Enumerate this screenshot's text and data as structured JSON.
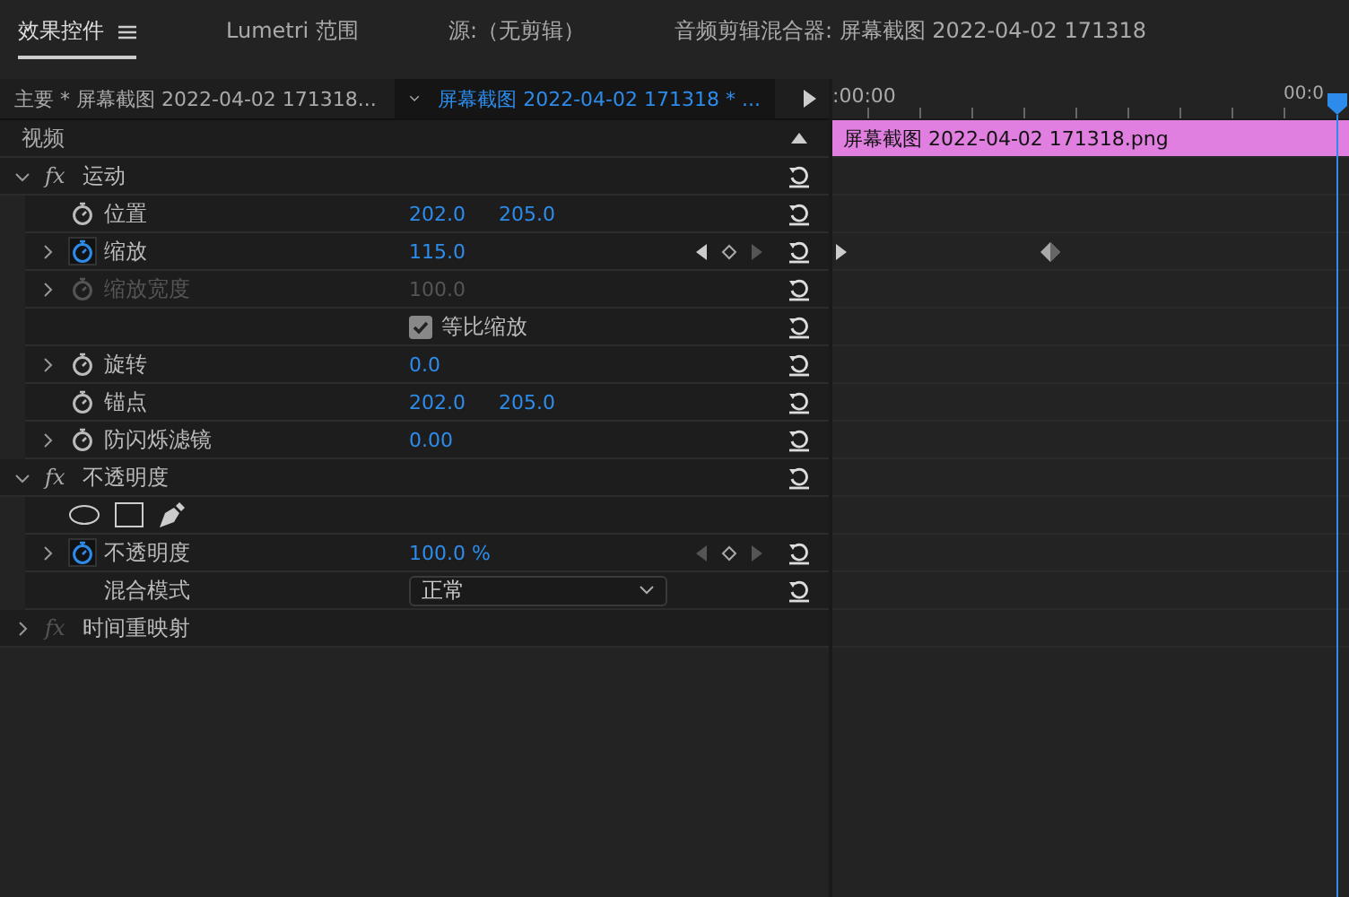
{
  "tabs": [
    {
      "label": "效果控件",
      "selected": true,
      "menu": true
    },
    {
      "label": "Lumetri 范围",
      "selected": false,
      "menu": false
    },
    {
      "label": "源:（无剪辑）",
      "selected": false,
      "menu": false
    },
    {
      "label": "音频剪辑混合器: 屏幕截图 2022-04-02 171318",
      "selected": false,
      "menu": false
    }
  ],
  "header": {
    "master_clip": "主要 * 屏幕截图 2022-04-02 171318...",
    "sequence_clip": "屏幕截图 2022-04-02 171318 * ..."
  },
  "timeline": {
    "time_start": ":00:00",
    "time_end": "00:0",
    "clip_label": "屏幕截图 2022-04-02  171318.png"
  },
  "section": {
    "label": "视频"
  },
  "effects": [
    {
      "name": "运动",
      "badge": "fx",
      "expanded": true,
      "fx_enabled": true,
      "resettable": true,
      "properties": [
        {
          "kind": "value",
          "name": "位置",
          "expandable": false,
          "stopwatch": true,
          "animated": false,
          "disabled": false,
          "values": [
            "202.0",
            "205.0"
          ],
          "resettable": true
        },
        {
          "kind": "value",
          "name": "缩放",
          "expandable": true,
          "stopwatch": true,
          "animated": true,
          "disabled": false,
          "values": [
            "115.0"
          ],
          "keyframe_nav": {
            "prev": true,
            "next": false
          },
          "keyframe": true,
          "resettable": true
        },
        {
          "kind": "value",
          "name": "缩放宽度",
          "expandable": true,
          "stopwatch": true,
          "animated": false,
          "disabled": true,
          "values": [
            "100.0"
          ],
          "resettable": true
        },
        {
          "kind": "checkbox",
          "label": "等比缩放",
          "checked": true,
          "resettable": true
        },
        {
          "kind": "value",
          "name": "旋转",
          "expandable": true,
          "stopwatch": true,
          "animated": false,
          "disabled": false,
          "values": [
            "0.0"
          ],
          "resettable": true
        },
        {
          "kind": "value",
          "name": "锚点",
          "expandable": false,
          "stopwatch": true,
          "animated": false,
          "disabled": false,
          "values": [
            "202.0",
            "205.0"
          ],
          "resettable": true
        },
        {
          "kind": "value",
          "name": "防闪烁滤镜",
          "expandable": true,
          "stopwatch": true,
          "animated": false,
          "disabled": false,
          "values": [
            "0.00"
          ],
          "resettable": true
        }
      ]
    },
    {
      "name": "不透明度",
      "badge": "fx",
      "expanded": true,
      "fx_enabled": true,
      "resettable": true,
      "properties": [
        {
          "kind": "masks"
        },
        {
          "kind": "value",
          "name": "不透明度",
          "expandable": true,
          "stopwatch": true,
          "animated": true,
          "disabled": false,
          "values": [
            "100.0 %"
          ],
          "keyframe_nav": {
            "prev": false,
            "next": false
          },
          "resettable": true
        },
        {
          "kind": "dropdown",
          "name": "混合模式",
          "value": "正常",
          "resettable": true
        }
      ]
    },
    {
      "name": "时间重映射",
      "badge": "fx",
      "expanded": false,
      "fx_enabled": false,
      "resettable": false
    }
  ]
}
